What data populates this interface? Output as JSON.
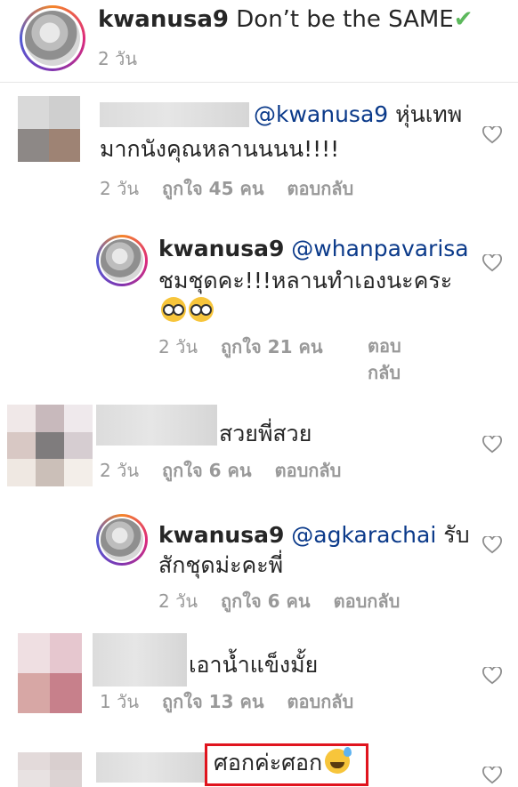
{
  "post": {
    "username": "kwanusa9",
    "caption": "Don’t be the SAME",
    "check_icon": "✔",
    "time": "2 วัน"
  },
  "comments": [
    {
      "mention": "@kwanusa9",
      "text_line1": "หุ่นเทพ",
      "text_line2": "มากนังคุณหลานนนน!!!!",
      "time": "2 วัน",
      "likes": "ถูกใจ 45 คน",
      "reply": "ตอบกลับ"
    },
    {
      "username": "kwanusa9",
      "mention": "@whanpavarisa",
      "text_line1": "ชมชุดคะ!!!หลานทำเองนะคระ",
      "emoji": "nerd-face-emoji x2",
      "time": "2 วัน",
      "likes": "ถูกใจ 21 คน",
      "reply_line1": "ตอบ",
      "reply_line2": "กลับ"
    },
    {
      "text_line1": "สวยพี่สวย",
      "time": "2 วัน",
      "likes": "ถูกใจ 6 คน",
      "reply": "ตอบกลับ"
    },
    {
      "username": "kwanusa9",
      "mention": "@agkarachai",
      "text_after_mention": "รับ",
      "text_line2": "สักชุดม่ะคะพี่",
      "time": "2 วัน",
      "likes": "ถูกใจ 6 คน",
      "reply": "ตอบกลับ"
    },
    {
      "text_line1": "เอาน้ำแข็งมั้ย",
      "time": "1 วัน",
      "likes": "ถูกใจ 13 คน",
      "reply": "ตอบกลับ"
    },
    {
      "text_line1": "ศอกค่ะศอก",
      "emoji": "sweat-smile-emoji"
    }
  ],
  "colors": {
    "highlight": "#e0141e",
    "mention": "#0b3a8a",
    "meta": "#999999",
    "check": "#5cb85c"
  }
}
